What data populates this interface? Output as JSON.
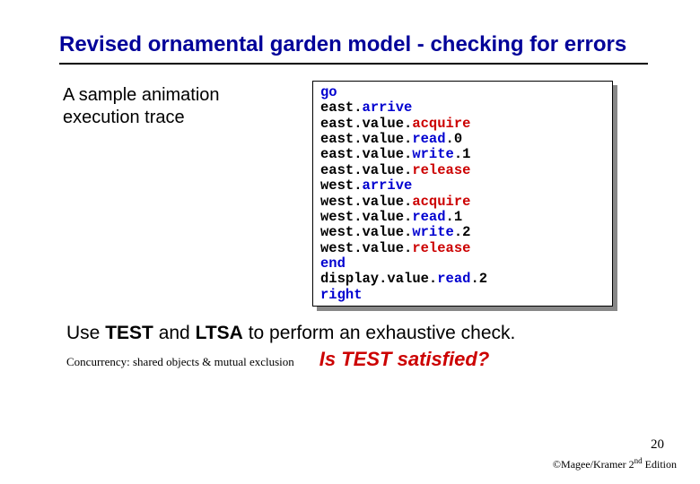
{
  "title": "Revised ornamental garden model - checking for errors",
  "left_text": "A sample animation execution trace",
  "trace": [
    [
      {
        "t": "go",
        "c": "blue"
      }
    ],
    [
      {
        "t": "east.",
        "c": ""
      },
      {
        "t": "arrive",
        "c": "blue"
      }
    ],
    [
      {
        "t": "east.value.",
        "c": ""
      },
      {
        "t": "acquire",
        "c": "red"
      }
    ],
    [
      {
        "t": "east.value.",
        "c": ""
      },
      {
        "t": "read",
        "c": "blue"
      },
      {
        "t": ".0",
        "c": ""
      }
    ],
    [
      {
        "t": "east.value.",
        "c": ""
      },
      {
        "t": "write",
        "c": "blue"
      },
      {
        "t": ".1",
        "c": ""
      }
    ],
    [
      {
        "t": "east.value.",
        "c": ""
      },
      {
        "t": "release",
        "c": "red"
      }
    ],
    [
      {
        "t": "west.",
        "c": ""
      },
      {
        "t": "arrive",
        "c": "blue"
      }
    ],
    [
      {
        "t": "west.value.",
        "c": ""
      },
      {
        "t": "acquire",
        "c": "red"
      }
    ],
    [
      {
        "t": "west.value.",
        "c": ""
      },
      {
        "t": "read",
        "c": "blue"
      },
      {
        "t": ".1",
        "c": ""
      }
    ],
    [
      {
        "t": "west.value.",
        "c": ""
      },
      {
        "t": "write",
        "c": "blue"
      },
      {
        "t": ".2",
        "c": ""
      }
    ],
    [
      {
        "t": "west.value.",
        "c": ""
      },
      {
        "t": "release",
        "c": "red"
      }
    ],
    [
      {
        "t": "end",
        "c": "blue"
      }
    ],
    [
      {
        "t": "display.value.",
        "c": ""
      },
      {
        "t": "read",
        "c": "blue"
      },
      {
        "t": ".2",
        "c": ""
      }
    ],
    [
      {
        "t": "right",
        "c": "blue"
      }
    ]
  ],
  "bottom": {
    "line1_pre": "Use ",
    "line1_test": "TEST",
    "line1_mid": " and ",
    "line1_ltsa": "LTSA",
    "line1_post": " to perform an exhaustive check.",
    "footer_left": "Concurrency: shared objects & mutual exclusion",
    "question": "Is TEST satisfied?"
  },
  "page_num": "20",
  "copyright_pre": "©Magee/Kramer ",
  "copyright_ed": "2",
  "copyright_sup": "nd",
  "copyright_post": " Edition"
}
